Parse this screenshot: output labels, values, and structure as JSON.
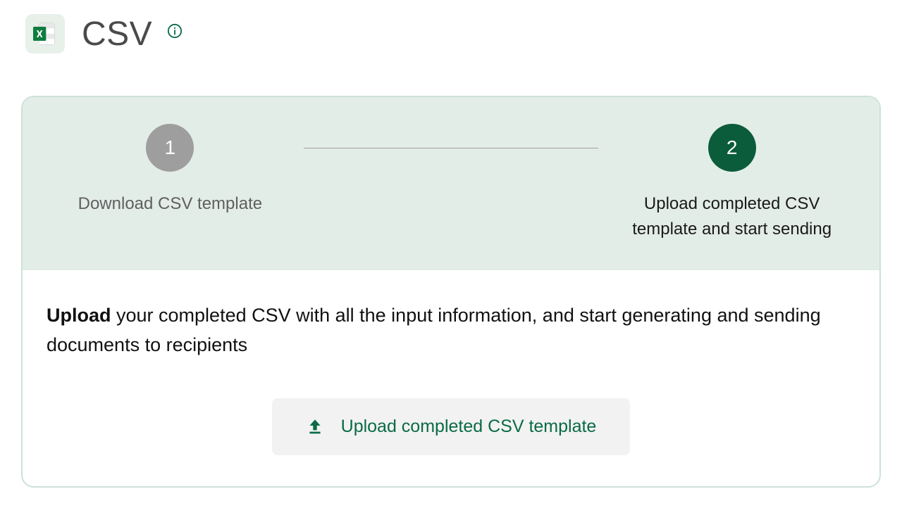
{
  "header": {
    "title": "CSV"
  },
  "stepper": {
    "steps": [
      {
        "number": "1",
        "label": "Download CSV template",
        "state": "inactive"
      },
      {
        "number": "2",
        "label": "Upload completed CSV template and start sending",
        "state": "active"
      }
    ]
  },
  "content": {
    "instruction_bold": "Upload",
    "instruction_rest": " your completed CSV with all the input information, and start generating and sending documents to recipients"
  },
  "actions": {
    "upload_label": "Upload completed CSV template"
  },
  "colors": {
    "accent": "#0a6b45",
    "active_step": "#0a5c3a",
    "inactive_step": "#9e9e9e",
    "card_border": "#cde2d9",
    "stepper_bg": "#e3ede8"
  }
}
